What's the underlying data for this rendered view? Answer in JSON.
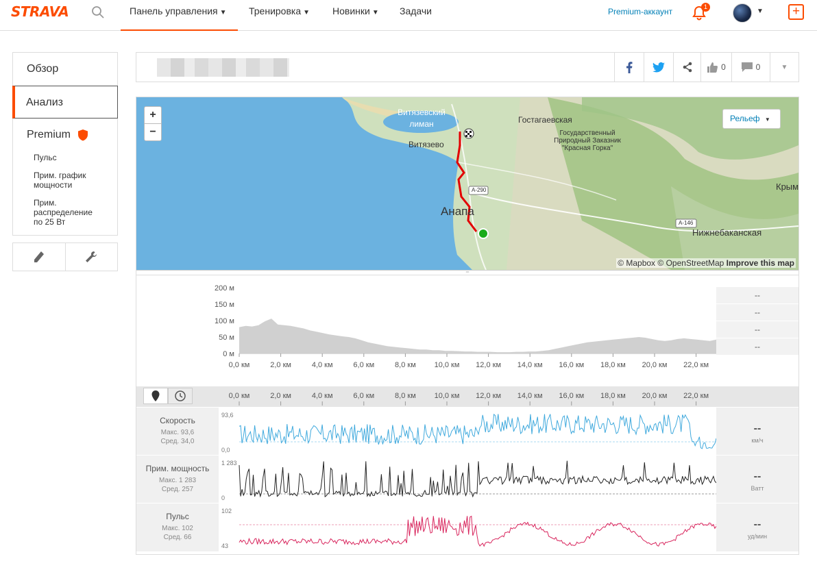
{
  "header": {
    "logo": "STRAVA",
    "nav": [
      {
        "label": "Панель управления",
        "chevron": true
      },
      {
        "label": "Тренировка",
        "chevron": true
      },
      {
        "label": "Новинки",
        "chevron": true
      },
      {
        "label": "Задачи",
        "chevron": false
      }
    ],
    "premium_link": "Premium-аккаунт",
    "notification_count": "1",
    "colors": {
      "brand": "#fc4c02",
      "link": "#007fb6"
    }
  },
  "sidebar": {
    "items": [
      {
        "label": "Обзор"
      },
      {
        "label": "Анализ"
      },
      {
        "label": "Premium"
      }
    ],
    "sub_items": [
      {
        "label": "Пульс"
      },
      {
        "label": "Прим. график мощности"
      },
      {
        "label": "Прим. распределение по 25 Вт"
      }
    ],
    "tools": [
      {
        "icon": "pencil-icon"
      },
      {
        "icon": "wrench-icon"
      }
    ]
  },
  "titlebar": {
    "kudos_count": "0",
    "comment_count": "0"
  },
  "map": {
    "zoom_in": "+",
    "zoom_out": "−",
    "layer_button": "Рельеф",
    "attribution": [
      "© Mapbox",
      "© OpenStreetMap",
      "Improve this map"
    ],
    "labels": [
      "Витязевский лиман",
      "Витязево",
      "Гостагаевская",
      "Государственный Природный Заказник \"Красная Горка\"",
      "Анапа",
      "Крым",
      "Нижнебаканская"
    ],
    "road_labels": [
      "A-290",
      "A-146"
    ],
    "colors": {
      "sea": "#6bb2e0",
      "route": "#e30000",
      "start": "#1aab1a"
    }
  },
  "elevation": {
    "y_ticks": [
      "200 м",
      "150 м",
      "100 м",
      "50 м",
      "0 м"
    ],
    "x_ticks": [
      "0,0 км",
      "2,0 км",
      "4,0 км",
      "6,0 км",
      "8,0 км",
      "10,0 км",
      "12,0 км",
      "14,0 км",
      "16,0 км",
      "18,0 км",
      "20,0 км",
      "22,0 км"
    ],
    "side_values": [
      "--",
      "--",
      "--",
      "--"
    ]
  },
  "streams": {
    "x_ticks": [
      "0,0 км",
      "2,0 км",
      "4,0 км",
      "6,0 км",
      "8,0 км",
      "10,0 км",
      "12,0 км",
      "14,0 км",
      "16,0 км",
      "18,0 км",
      "20,0 км",
      "22,0 км"
    ],
    "rows": [
      {
        "name": "Скорость",
        "max": "Макс. 93,6",
        "avg": "Сред. 34,0",
        "ymax": "93,6",
        "ymin": "0,0",
        "value": "--",
        "unit": "км/ч",
        "color": "#3fa9dd"
      },
      {
        "name": "Прим. мощность",
        "max": "Макс. 1 283",
        "avg": "Сред. 257",
        "ymax": "1 283",
        "ymin": "0",
        "value": "--",
        "unit": "Ватт",
        "color": "#222222"
      },
      {
        "name": "Пульс",
        "max": "Макс. 102",
        "avg": "Сред. 66",
        "ymax": "102",
        "ymin": "43",
        "value": "--",
        "unit": "уд/мин",
        "color": "#d8245c"
      }
    ]
  }
}
